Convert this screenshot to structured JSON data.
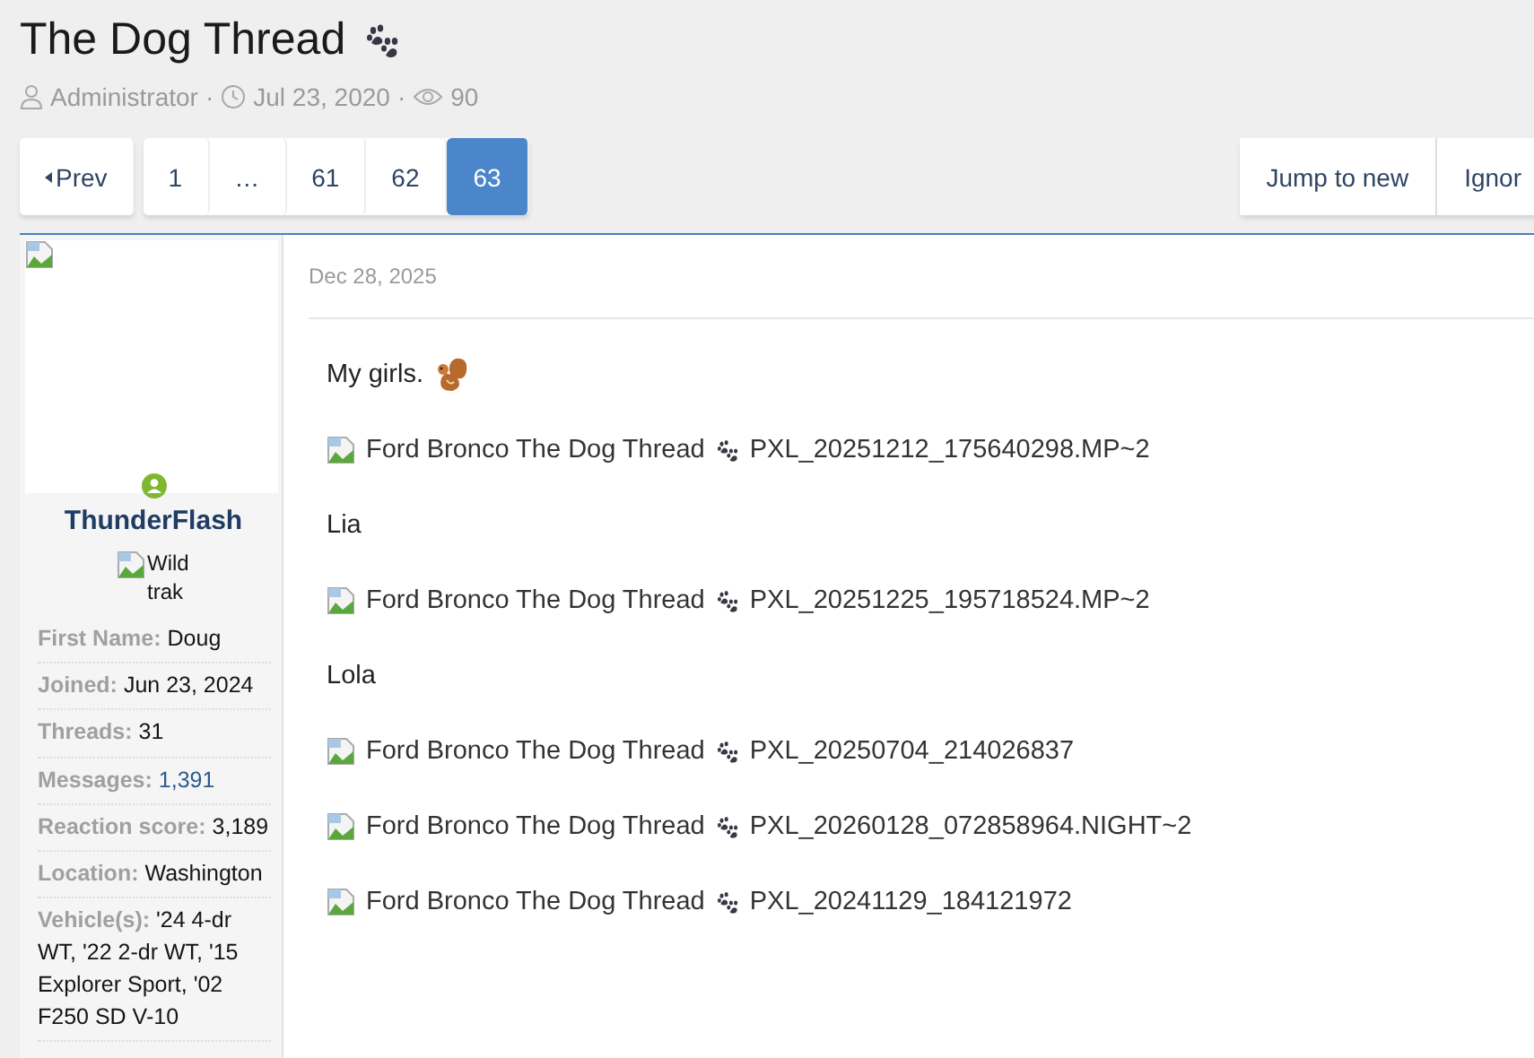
{
  "thread": {
    "title": "The Dog Thread",
    "author": "Administrator",
    "date": "Jul 23, 2020",
    "views": "90",
    "separator": "·"
  },
  "pagination": {
    "prev": "Prev",
    "pages": [
      {
        "label": "1",
        "selected": false
      },
      {
        "label": "…",
        "selected": false
      },
      {
        "label": "61",
        "selected": false
      },
      {
        "label": "62",
        "selected": false
      },
      {
        "label": "63",
        "selected": true
      }
    ]
  },
  "actions": [
    "Jump to new",
    "Ignor"
  ],
  "post": {
    "user": {
      "name": "ThunderFlash",
      "online": true,
      "banner_alt": "Wildtrak",
      "stats": [
        {
          "label": "First Name:",
          "value": "Doug"
        },
        {
          "label": "Joined:",
          "value": "Jun 23, 2024"
        },
        {
          "label": "Threads:",
          "value": "31"
        },
        {
          "label": "Messages:",
          "value": "1,391",
          "link": true
        },
        {
          "label": "Reaction score:",
          "value": "3,189"
        },
        {
          "label": "Location:",
          "value": "Washington"
        },
        {
          "label": "Vehicle(s):",
          "value": "'24 4-dr WT, '22 2-dr WT, '15 Explorer Sport, '02 F250 SD V-10"
        }
      ]
    },
    "date": "Dec 28, 2025",
    "body": [
      {
        "kind": "text",
        "text": "My girls.",
        "emoji": true
      },
      {
        "kind": "image",
        "caption": "Ford Bronco The Dog Thread",
        "file": "PXL_20251212_175640298.MP~2"
      },
      {
        "kind": "text",
        "text": "Lia"
      },
      {
        "kind": "image",
        "caption": "Ford Bronco The Dog Thread",
        "file": "PXL_20251225_195718524.MP~2"
      },
      {
        "kind": "text",
        "text": "Lola"
      },
      {
        "kind": "image",
        "caption": "Ford Bronco The Dog Thread",
        "file": "PXL_20250704_214026837"
      },
      {
        "kind": "image",
        "caption": "Ford Bronco The Dog Thread",
        "file": "PXL_20260128_072858964.NIGHT~2"
      },
      {
        "kind": "image",
        "caption": "Ford Bronco The Dog Thread",
        "file": "PXL_20241129_184121972"
      }
    ]
  }
}
